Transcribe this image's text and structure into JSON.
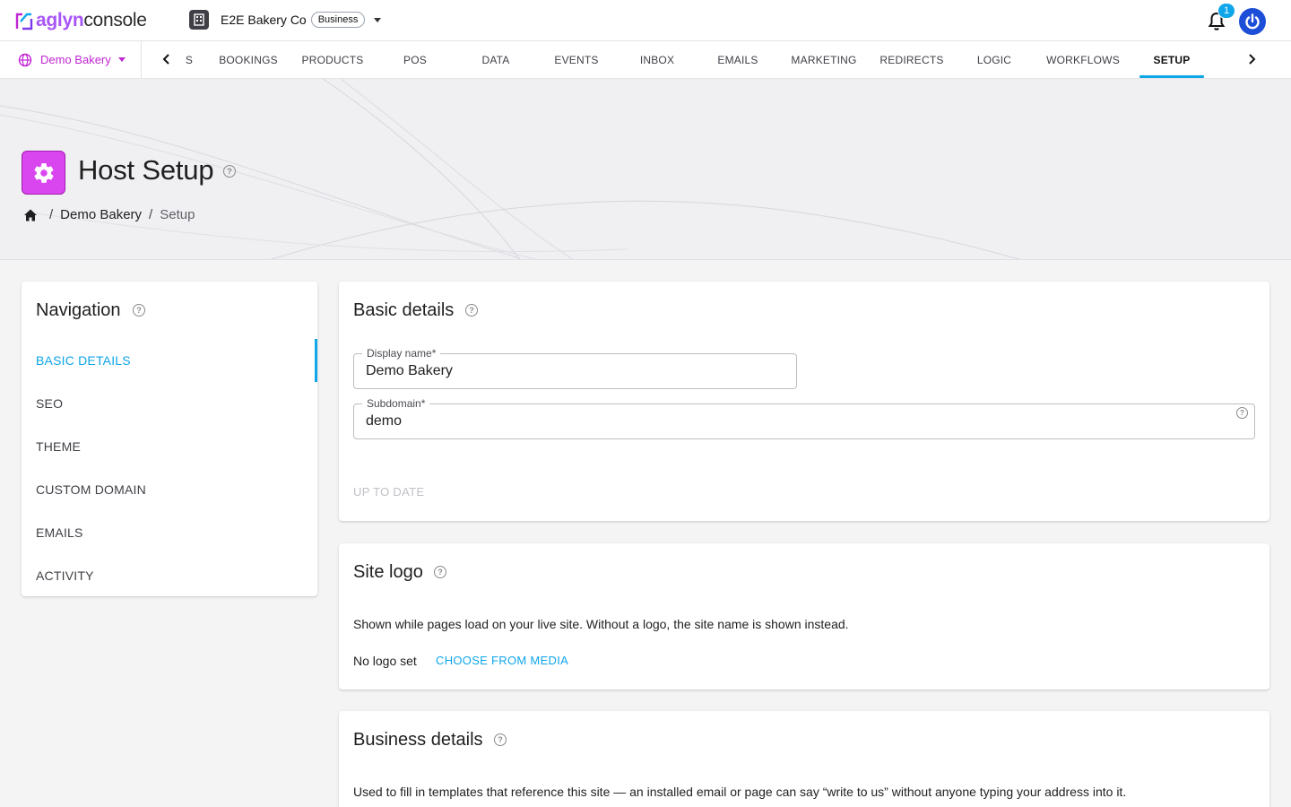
{
  "app": {
    "logo_part1": "aglyn",
    "logo_part2": "console",
    "org_name": "E2E Bakery Co",
    "org_plan": "Business",
    "notification_count": "1"
  },
  "site_selector": {
    "label": "Demo Bakery"
  },
  "tabs": [
    {
      "label": "S"
    },
    {
      "label": "BOOKINGS"
    },
    {
      "label": "PRODUCTS"
    },
    {
      "label": "POS"
    },
    {
      "label": "DATA"
    },
    {
      "label": "EVENTS"
    },
    {
      "label": "INBOX"
    },
    {
      "label": "EMAILS"
    },
    {
      "label": "MARKETING"
    },
    {
      "label": "REDIRECTS"
    },
    {
      "label": "LOGIC"
    },
    {
      "label": "WORKFLOWS"
    },
    {
      "label": "SETUP",
      "active": true
    }
  ],
  "page": {
    "title": "Host Setup",
    "breadcrumb": {
      "sep": "/",
      "site": "Demo Bakery",
      "current": "Setup"
    }
  },
  "navigation": {
    "title": "Navigation",
    "items": [
      {
        "label": "BASIC DETAILS",
        "active": true
      },
      {
        "label": "SEO"
      },
      {
        "label": "THEME"
      },
      {
        "label": "CUSTOM DOMAIN"
      },
      {
        "label": "EMAILS"
      },
      {
        "label": "ACTIVITY"
      }
    ]
  },
  "basic_details": {
    "title": "Basic details",
    "display_name": {
      "label": "Display name*",
      "value": "Demo Bakery"
    },
    "subdomain": {
      "label": "Subdomain*",
      "value": "demo"
    },
    "status_button": "UP TO DATE"
  },
  "site_logo": {
    "title": "Site logo",
    "description": "Shown while pages load on your live site. Without a logo, the site name is shown instead.",
    "status": "No logo set",
    "action": "CHOOSE FROM MEDIA"
  },
  "business_details": {
    "title": "Business details",
    "description": "Used to fill in templates that reference this site — an installed email or page can say “write to us” without anyone typing your address into it."
  },
  "colors": {
    "accent": "#0ea5e9",
    "brand": "#d946ef",
    "avatar": "#1d4ed8"
  }
}
